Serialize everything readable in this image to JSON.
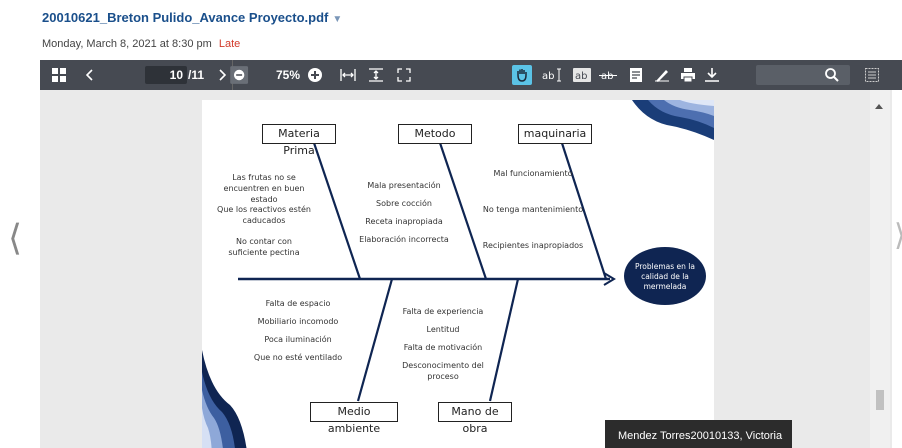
{
  "header": {
    "file_title": "20010621_Breton Pulido_Avance Proyecto.pdf",
    "caret": "▼",
    "date": "Monday, March 8, 2021 at 8:30 pm",
    "late_label": "Late"
  },
  "toolbar": {
    "current_page": "10",
    "total_pages": "/11",
    "zoom": "75%"
  },
  "diagram": {
    "categories": {
      "materia_prima": "Materia Prima",
      "metodo": "Metodo",
      "maquinaria": "maquinaria",
      "medio_ambiente": "Medio ambiente",
      "mano_de_obra": "Mano de obra"
    },
    "materia_prima_causes": [
      "Las frutas no se encuentren en buen estado",
      "Que los reactivos estén caducados",
      "No contar con suficiente pectina"
    ],
    "metodo_causes": [
      "Mala presentación",
      "Sobre cocción",
      "Receta inapropiada",
      "Elaboración incorrecta"
    ],
    "maquinaria_causes": [
      "Mal funcionamiento",
      "No tenga mantenimiento",
      "Recipientes inapropiados"
    ],
    "medio_ambiente_causes": [
      "Falta de espacio",
      "Mobiliario incomodo",
      "Poca iluminación",
      "Que no esté ventilado"
    ],
    "mano_de_obra_causes": [
      "Falta de experiencia",
      "Lentitud",
      "Falta de motivación",
      "Desconocimento del proceso"
    ],
    "effect": "Problemas en la calidad de la mermelada"
  },
  "tooltip": "Mendez Torres20010133, Victoria",
  "colors": {
    "accent": "#5bc3e6",
    "toolbar": "#464a52",
    "title": "#1a4f8b",
    "late": "#d23a2a",
    "navy": "#0f2552"
  }
}
